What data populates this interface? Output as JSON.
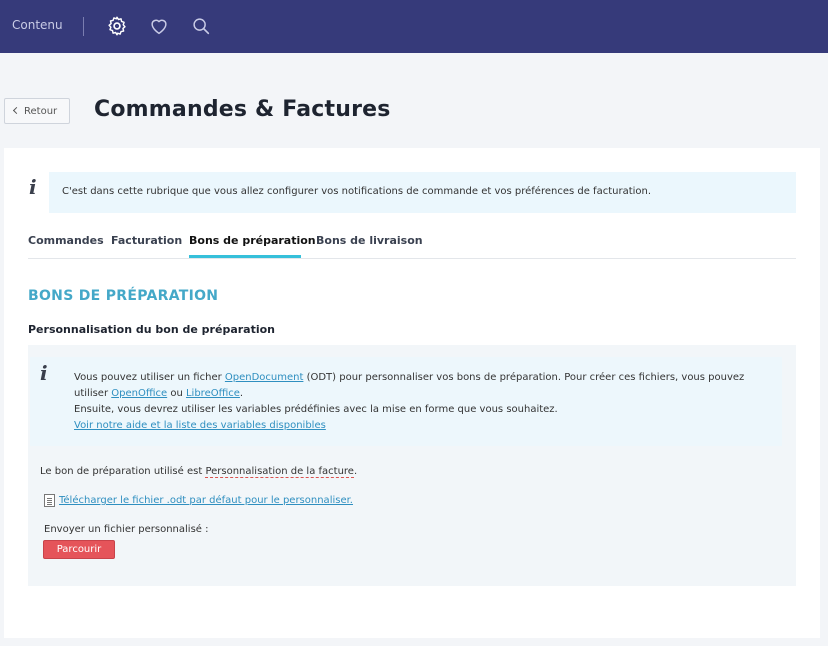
{
  "topbar": {
    "contenu_label": "Contenu",
    "icons": [
      "gear-icon",
      "heart-icon",
      "search-icon"
    ],
    "background": "#363a7a"
  },
  "header": {
    "back_label": "Retour",
    "title": "Commandes & Factures"
  },
  "intro": {
    "text": "C'est dans cette rubrique que vous allez configurer vos notifications de commande et vos préférences de facturation."
  },
  "tabs": [
    {
      "label": "Commandes",
      "active": false
    },
    {
      "label": "Facturation",
      "active": false
    },
    {
      "label": "Bons de préparation",
      "active": true
    },
    {
      "label": "Bons de livraison",
      "active": false
    }
  ],
  "section": {
    "title": "BONS DE PRÉPARATION",
    "subtitle": "Personnalisation du bon de préparation"
  },
  "info": {
    "line1_pre": "Vous pouvez utiliser un ficher ",
    "line1_link": "OpenDocument",
    "line1_post": " (ODT) pour personnaliser vos bons de préparation. Pour créer ces fichiers, vous pouvez",
    "line2_pre": "utiliser ",
    "line2_link1": "OpenOffice",
    "line2_mid": " ou ",
    "line2_link2": "LibreOffice",
    "line2_post": ".",
    "line3": "Ensuite, vous devrez utiliser les variables prédéfinies avec la mise en forme que vous souhaitez.",
    "help_link": "Voir notre aide et la liste des variables disponibles"
  },
  "status": {
    "pre": "Le bon de préparation utilisé est ",
    "value": "Personnalisation de la facture",
    "post": "."
  },
  "download": {
    "label": "Télécharger le fichier .odt par défaut pour le personnaliser."
  },
  "upload": {
    "label": "Envoyer un fichier personnalisé :",
    "button": "Parcourir"
  },
  "colors": {
    "accent": "#36c0da",
    "section_title": "#44a8c8",
    "link": "#2f8fc0",
    "button": "#e5545a"
  }
}
